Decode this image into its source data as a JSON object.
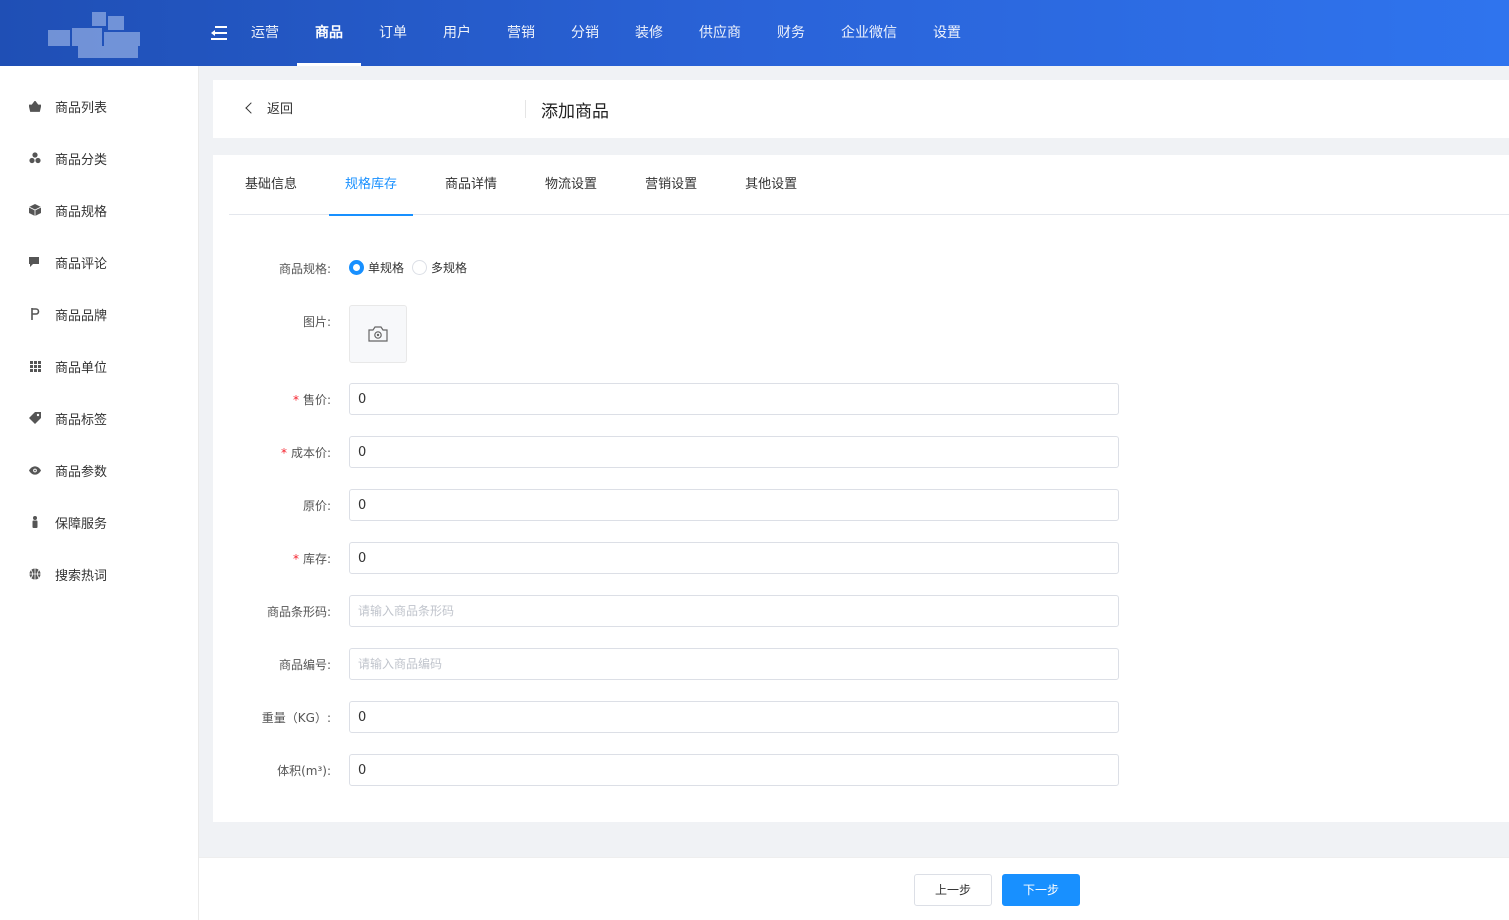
{
  "header": {
    "nav": [
      {
        "label": "运营",
        "active": false
      },
      {
        "label": "商品",
        "active": true
      },
      {
        "label": "订单",
        "active": false
      },
      {
        "label": "用户",
        "active": false
      },
      {
        "label": "营销",
        "active": false
      },
      {
        "label": "分销",
        "active": false
      },
      {
        "label": "装修",
        "active": false
      },
      {
        "label": "供应商",
        "active": false
      },
      {
        "label": "财务",
        "active": false
      },
      {
        "label": "企业微信",
        "active": false
      },
      {
        "label": "设置",
        "active": false
      }
    ]
  },
  "sidebar": {
    "items": [
      {
        "label": "商品列表",
        "icon": "basket-icon"
      },
      {
        "label": "商品分类",
        "icon": "category-icon"
      },
      {
        "label": "商品规格",
        "icon": "cube-icon"
      },
      {
        "label": "商品评论",
        "icon": "comment-icon"
      },
      {
        "label": "商品品牌",
        "icon": "brand-icon"
      },
      {
        "label": "商品单位",
        "icon": "grid-icon"
      },
      {
        "label": "商品标签",
        "icon": "tag-icon"
      },
      {
        "label": "商品参数",
        "icon": "eye-icon"
      },
      {
        "label": "保障服务",
        "icon": "service-icon"
      },
      {
        "label": "搜索热词",
        "icon": "basketball-icon"
      }
    ]
  },
  "title_bar": {
    "back_label": "返回",
    "title": "添加商品"
  },
  "tabs": [
    {
      "label": "基础信息",
      "active": false
    },
    {
      "label": "规格库存",
      "active": true
    },
    {
      "label": "商品详情",
      "active": false
    },
    {
      "label": "物流设置",
      "active": false
    },
    {
      "label": "营销设置",
      "active": false
    },
    {
      "label": "其他设置",
      "active": false
    }
  ],
  "form": {
    "spec": {
      "label": "商品规格:",
      "options": [
        {
          "label": "单规格",
          "selected": true
        },
        {
          "label": "多规格",
          "selected": false
        }
      ]
    },
    "image": {
      "label": "图片:"
    },
    "sale_price": {
      "label": "售价:",
      "required": "*",
      "value": "0"
    },
    "cost_price": {
      "label": "成本价:",
      "required": "*",
      "value": "0"
    },
    "original_price": {
      "label": "原价:",
      "value": "0"
    },
    "stock": {
      "label": "库存:",
      "required": "*",
      "value": "0"
    },
    "barcode": {
      "label": "商品条形码:",
      "value": "",
      "placeholder": "请输入商品条形码"
    },
    "code": {
      "label": "商品编号:",
      "value": "",
      "placeholder": "请输入商品编码"
    },
    "weight": {
      "label": "重量（KG）:",
      "value": "0"
    },
    "volume": {
      "label": "体积(m³):",
      "value": "0"
    }
  },
  "footer": {
    "prev_label": "上一步",
    "next_label": "下一步"
  },
  "colors": {
    "primary": "#1890ff",
    "header_start": "#1f4fb5",
    "header_end": "#2f74ee",
    "required": "#f5222d"
  }
}
